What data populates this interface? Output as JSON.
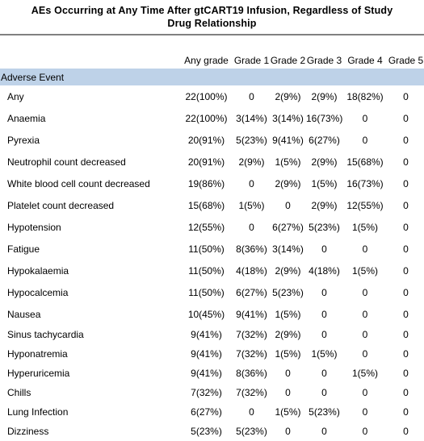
{
  "title": "AEs Occurring at Any Time After gtCART19 Infusion, Regardless of Study Drug Relationship",
  "columns": {
    "label": "",
    "any_grade": "Any grade",
    "grade_1": "Grade 1",
    "grade_2": "Grade 2",
    "grade_3": "Grade 3",
    "grade_4": "Grade 4",
    "grade_5": "Grade 5"
  },
  "section_header": "Adverse Event",
  "colors": {
    "section_band": "#bed2e8",
    "title_rule": "#808080",
    "text": "#000000",
    "background": "#ffffff"
  },
  "rows": [
    {
      "event": "Any",
      "any_grade": "22(100%)",
      "grade_1": "0",
      "grade_2": "2(9%)",
      "grade_3": "2(9%)",
      "grade_4": "18(82%)",
      "grade_5": "0"
    },
    {
      "event": "Anaemia",
      "any_grade": "22(100%)",
      "grade_1": "3(14%)",
      "grade_2": "3(14%)",
      "grade_3": "16(73%)",
      "grade_4": "0",
      "grade_5": "0"
    },
    {
      "event": "Pyrexia",
      "any_grade": "20(91%)",
      "grade_1": "5(23%)",
      "grade_2": "9(41%)",
      "grade_3": "6(27%)",
      "grade_4": "0",
      "grade_5": "0"
    },
    {
      "event": "Neutrophil count decreased",
      "any_grade": "20(91%)",
      "grade_1": "2(9%)",
      "grade_2": "1(5%)",
      "grade_3": "2(9%)",
      "grade_4": "15(68%)",
      "grade_5": "0"
    },
    {
      "event": "White blood cell count decreased",
      "any_grade": "19(86%)",
      "grade_1": "0",
      "grade_2": "2(9%)",
      "grade_3": "1(5%)",
      "grade_4": "16(73%)",
      "grade_5": "0"
    },
    {
      "event": "Platelet count decreased",
      "any_grade": "15(68%)",
      "grade_1": "1(5%)",
      "grade_2": "0",
      "grade_3": "2(9%)",
      "grade_4": "12(55%)",
      "grade_5": "0"
    },
    {
      "event": "Hypotension",
      "any_grade": "12(55%)",
      "grade_1": "0",
      "grade_2": "6(27%)",
      "grade_3": "5(23%)",
      "grade_4": "1(5%)",
      "grade_5": "0"
    },
    {
      "event": "Fatigue",
      "any_grade": "11(50%)",
      "grade_1": "8(36%)",
      "grade_2": "3(14%)",
      "grade_3": "0",
      "grade_4": "0",
      "grade_5": "0"
    },
    {
      "event": "Hypokalaemia",
      "any_grade": "11(50%)",
      "grade_1": "4(18%)",
      "grade_2": "2(9%)",
      "grade_3": "4(18%)",
      "grade_4": "1(5%)",
      "grade_5": "0"
    },
    {
      "event": "Hypocalcemia",
      "any_grade": "11(50%)",
      "grade_1": "6(27%)",
      "grade_2": "5(23%)",
      "grade_3": "0",
      "grade_4": "0",
      "grade_5": "0"
    },
    {
      "event": "Nausea",
      "any_grade": "10(45%)",
      "grade_1": "9(41%)",
      "grade_2": "1(5%)",
      "grade_3": "0",
      "grade_4": "0",
      "grade_5": "0"
    },
    {
      "event": "Sinus tachycardia",
      "any_grade": "9(41%)",
      "grade_1": "7(32%)",
      "grade_2": "2(9%)",
      "grade_3": "0",
      "grade_4": "0",
      "grade_5": "0"
    },
    {
      "event": "Hyponatremia",
      "any_grade": "9(41%)",
      "grade_1": "7(32%)",
      "grade_2": "1(5%)",
      "grade_3": "1(5%)",
      "grade_4": "0",
      "grade_5": "0"
    },
    {
      "event": "Hyperuricemia",
      "any_grade": "9(41%)",
      "grade_1": "8(36%)",
      "grade_2": "0",
      "grade_3": "0",
      "grade_4": "1(5%)",
      "grade_5": "0"
    },
    {
      "event": "Chills",
      "any_grade": "7(32%)",
      "grade_1": "7(32%)",
      "grade_2": "0",
      "grade_3": "0",
      "grade_4": "0",
      "grade_5": "0"
    },
    {
      "event": "Lung Infection",
      "any_grade": "6(27%)",
      "grade_1": "0",
      "grade_2": "1(5%)",
      "grade_3": "5(23%)",
      "grade_4": "0",
      "grade_5": "0"
    },
    {
      "event": "Dizziness",
      "any_grade": "5(23%)",
      "grade_1": "5(23%)",
      "grade_2": "0",
      "grade_3": "0",
      "grade_4": "0",
      "grade_5": "0"
    }
  ],
  "chart_data": {
    "type": "table",
    "title": "AEs Occurring at Any Time After gtCART19 Infusion, Regardless of Study Drug Relationship",
    "columns": [
      "Adverse Event",
      "Any grade",
      "Grade 1",
      "Grade 2",
      "Grade 3",
      "Grade 4",
      "Grade 5"
    ],
    "total_patients": 22,
    "rows": [
      [
        "Any",
        "22(100%)",
        "0",
        "2(9%)",
        "2(9%)",
        "18(82%)",
        "0"
      ],
      [
        "Anaemia",
        "22(100%)",
        "3(14%)",
        "3(14%)",
        "16(73%)",
        "0",
        "0"
      ],
      [
        "Pyrexia",
        "20(91%)",
        "5(23%)",
        "9(41%)",
        "6(27%)",
        "0",
        "0"
      ],
      [
        "Neutrophil count decreased",
        "20(91%)",
        "2(9%)",
        "1(5%)",
        "2(9%)",
        "15(68%)",
        "0"
      ],
      [
        "White blood cell count decreased",
        "19(86%)",
        "0",
        "2(9%)",
        "1(5%)",
        "16(73%)",
        "0"
      ],
      [
        "Platelet count decreased",
        "15(68%)",
        "1(5%)",
        "0",
        "2(9%)",
        "12(55%)",
        "0"
      ],
      [
        "Hypotension",
        "12(55%)",
        "0",
        "6(27%)",
        "5(23%)",
        "1(5%)",
        "0"
      ],
      [
        "Fatigue",
        "11(50%)",
        "8(36%)",
        "3(14%)",
        "0",
        "0",
        "0"
      ],
      [
        "Hypokalaemia",
        "11(50%)",
        "4(18%)",
        "2(9%)",
        "4(18%)",
        "1(5%)",
        "0"
      ],
      [
        "Hypocalcemia",
        "11(50%)",
        "6(27%)",
        "5(23%)",
        "0",
        "0",
        "0"
      ],
      [
        "Nausea",
        "10(45%)",
        "9(41%)",
        "1(5%)",
        "0",
        "0",
        "0"
      ],
      [
        "Sinus tachycardia",
        "9(41%)",
        "7(32%)",
        "2(9%)",
        "0",
        "0",
        "0"
      ],
      [
        "Hyponatremia",
        "9(41%)",
        "7(32%)",
        "1(5%)",
        "1(5%)",
        "0",
        "0"
      ],
      [
        "Hyperuricemia",
        "9(41%)",
        "8(36%)",
        "0",
        "0",
        "1(5%)",
        "0"
      ],
      [
        "Chills",
        "7(32%)",
        "7(32%)",
        "0",
        "0",
        "0",
        "0"
      ],
      [
        "Lung Infection",
        "6(27%)",
        "0",
        "1(5%)",
        "5(23%)",
        "0",
        "0"
      ],
      [
        "Dizziness",
        "5(23%)",
        "5(23%)",
        "0",
        "0",
        "0",
        "0"
      ]
    ]
  }
}
